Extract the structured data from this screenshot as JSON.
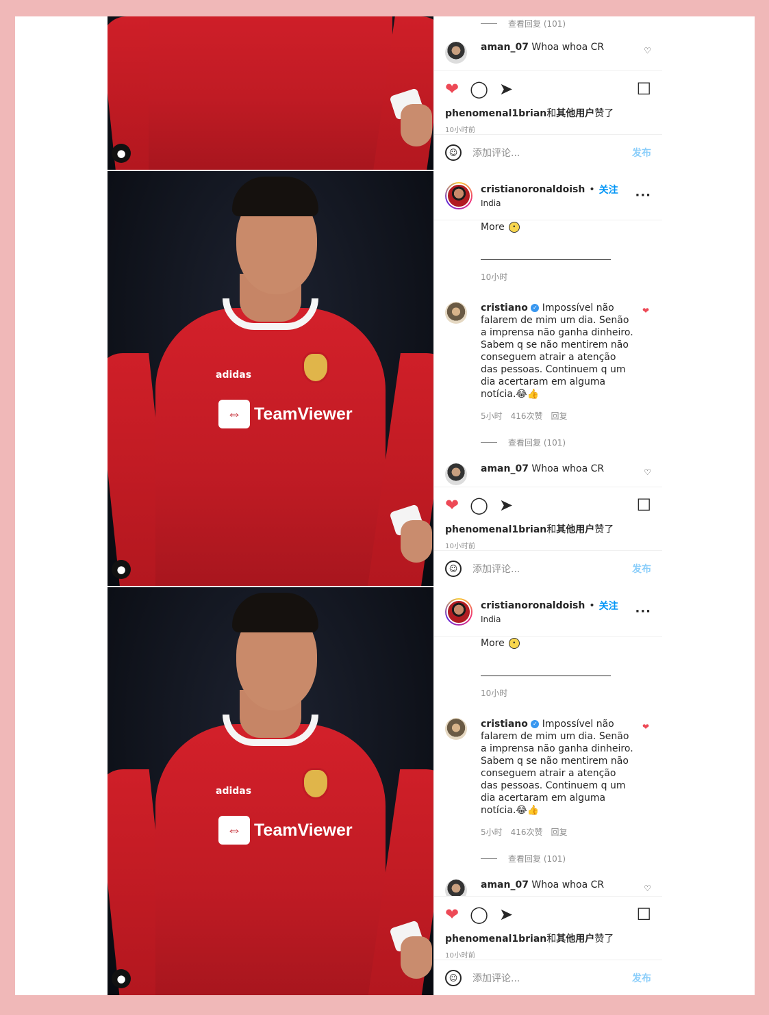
{
  "posts": [
    {
      "header": {
        "username": "cristianoronaldoish",
        "follow": "关注",
        "location": "India"
      },
      "caption_more": "More",
      "caption_time": "10小时",
      "comment": {
        "username": "cristiano",
        "text": "Impossível não falarem de mim um dia. Senão a imprensa não ganha dinheiro. Sabem q se não mentirem não conseguem atrair a atenção das pessoas. Continuem q um dia acertaram em alguma notícia.😂👍",
        "time": "5小时",
        "likes": "416次赞",
        "reply": "回复"
      },
      "view_replies": "查看回复 (101)",
      "comment2": {
        "username": "aman_07",
        "text": "Whoa whoa CR"
      },
      "liked_by_user": "phenomenal1brian",
      "liked_by_suffix": "和",
      "liked_by_others": "其他用户",
      "liked_by_end": "赞了",
      "time_ago": "10小时前",
      "add_comment_placeholder": "添加评论...",
      "post_button": "发布"
    }
  ],
  "icons": {
    "heart": "heart-icon",
    "comment": "comment-icon",
    "share": "share-icon",
    "bookmark": "bookmark-icon",
    "emoji": "emoji-icon",
    "more": "more-options-icon",
    "user_tag": "user-tag-icon"
  },
  "colors": {
    "background": "#f0b8b8",
    "accent_blue": "#0095f6",
    "like_red": "#ed4956",
    "jersey_red": "#c01b24"
  },
  "sponsor_text": "TeamViewer",
  "kit_brand": "adidas"
}
